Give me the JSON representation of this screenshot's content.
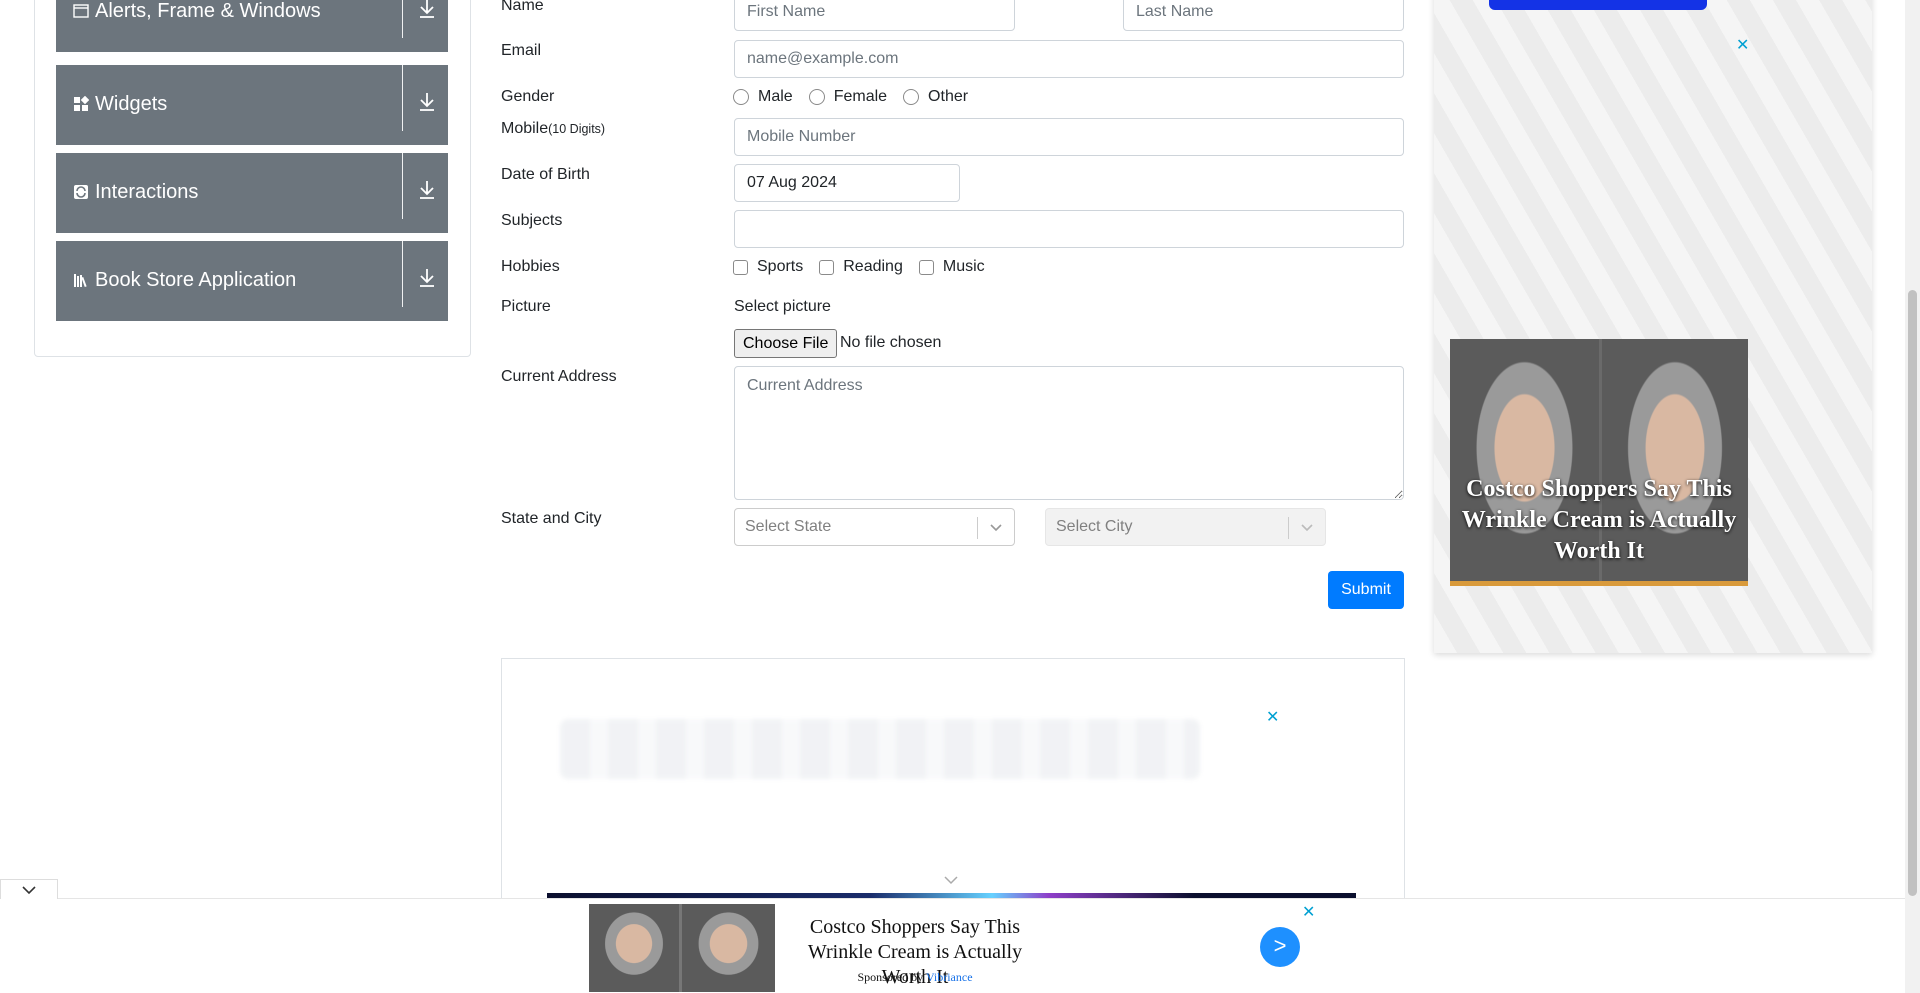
{
  "sidebar": {
    "groups": [
      {
        "label": "Alerts, Frame & Windows",
        "icon": "window-icon"
      },
      {
        "label": "Widgets",
        "icon": "widgets-icon"
      },
      {
        "label": "Interactions",
        "icon": "interactions-icon"
      },
      {
        "label": "Book Store Application",
        "icon": "books-icon"
      }
    ]
  },
  "form": {
    "name_label": "Name",
    "first_name_placeholder": "First Name",
    "last_name_placeholder": "Last Name",
    "email_label": "Email",
    "email_placeholder": "name@example.com",
    "gender_label": "Gender",
    "gender_options": [
      "Male",
      "Female",
      "Other"
    ],
    "mobile_label": "Mobile",
    "mobile_hint": "(10 Digits)",
    "mobile_placeholder": "Mobile Number",
    "dob_label": "Date of Birth",
    "dob_value": "07 Aug 2024",
    "subjects_label": "Subjects",
    "hobbies_label": "Hobbies",
    "hobby_options": [
      "Sports",
      "Reading",
      "Music"
    ],
    "picture_label": "Picture",
    "select_picture": "Select picture",
    "choose_file": "Choose File",
    "no_file": "No file chosen",
    "address_label": "Current Address",
    "address_placeholder": "Current Address",
    "state_city_label": "State and City",
    "state_placeholder": "Select State",
    "city_placeholder": "Select City",
    "submit_label": "Submit"
  },
  "ads": {
    "side_headline": "Costco Shoppers Say This Wrinkle Cream is Actually Worth It",
    "sticky_title": "Costco Shoppers Say This Wrinkle Cream is Actually Worth It",
    "sticky_sponsor_prefix": "Sponsored by",
    "sticky_sponsor_name": "Vibriance",
    "sticky_go": ">",
    "close_glyph": "✕"
  },
  "colors": {
    "accent": "#007bff",
    "sidebar_group_bg": "#6c757d",
    "ad_close": "#00a0d2"
  }
}
